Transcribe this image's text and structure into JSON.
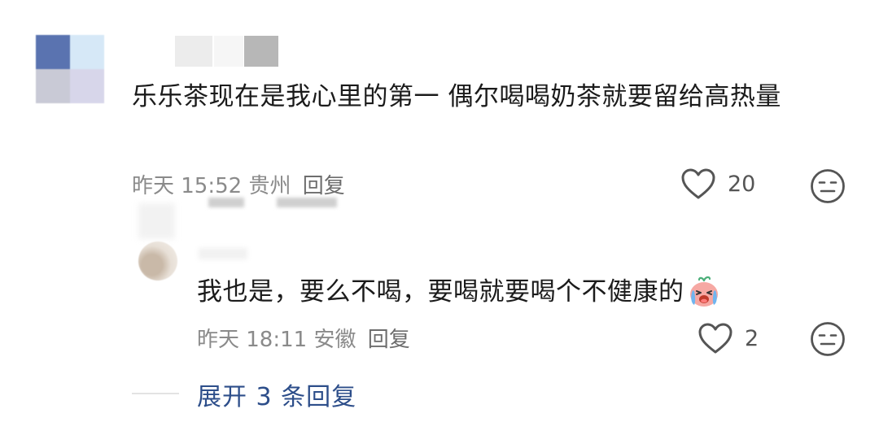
{
  "main_comment": {
    "text": "乐乐茶现在是我心里的第一 偶尔喝喝奶茶就要留给高热量",
    "time": "昨天 15:52",
    "location": "贵州",
    "reply_label": "回复",
    "likes": "20"
  },
  "reply": {
    "text": "我也是，要么不喝，要喝就要喝个不健康的",
    "time": "昨天 18:11",
    "location": "安徽",
    "reply_label": "回复",
    "likes": "2"
  },
  "expand": {
    "label": "展开 3 条回复"
  },
  "colors": {
    "link": "#2d4e8a",
    "meta": "#8a8a8a",
    "text": "#1b1b1b"
  },
  "icons": {
    "like": "heart-outline-icon",
    "dislike": "meh-face-icon",
    "emoji": "crying-face-emoji"
  }
}
